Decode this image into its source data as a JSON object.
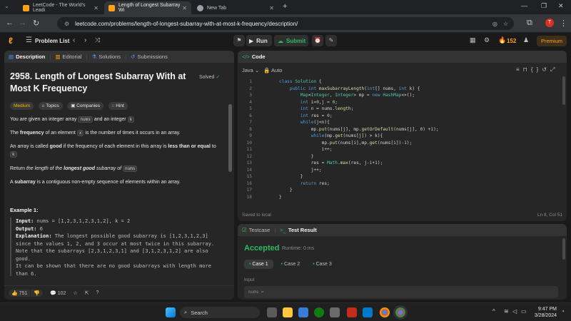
{
  "browser": {
    "tabs": [
      {
        "title": "LeetCode - The World's Leadi",
        "active": false
      },
      {
        "title": "Length of Longest Subarray Wi",
        "active": true
      },
      {
        "title": "New Tab",
        "active": false
      }
    ],
    "url": "leetcode.com/problems/length-of-longest-subarray-with-at-most-k-frequency/description/"
  },
  "lc_top": {
    "problem_list": "Problem List",
    "run": "Run",
    "submit": "Submit",
    "streak": "152",
    "premium": "Premium"
  },
  "desc_panel": {
    "tabs": [
      "Description",
      "Editorial",
      "Solutions",
      "Submissions"
    ],
    "title": "2958. Length of Longest Subarray With at Most K Frequency",
    "solved": "Solved",
    "difficulty": "Medium",
    "chips": [
      "Topics",
      "Companies",
      "Hint"
    ],
    "p1_a": "You are given an integer array",
    "p1_code1": "nums",
    "p1_b": "and an integer",
    "p1_code2": "k",
    "p2_a": "The",
    "p2_bold": "frequency",
    "p2_b": "of an element",
    "p2_code": "x",
    "p2_c": "is the number of times it occurs in an array.",
    "p3_a": "An array is called",
    "p3_bold1": "good",
    "p3_b": "if the frequency of each element in this array is",
    "p3_bold2": "less than or equal",
    "p3_c": "to",
    "p3_code": "k",
    "p4_a": "Return",
    "p4_i1": "the length of the",
    "p4_bold": "longest good",
    "p4_i2": "subarray of",
    "p4_code": "nums",
    "p5_a": "A",
    "p5_bold": "subarray",
    "p5_b": "is a contiguous non-empty sequence of elements within an array.",
    "example_title": "Example 1:",
    "ex_input_label": "Input:",
    "ex_input": "nums = [1,2,3,1,2,3,1,2], k = 2",
    "ex_output_label": "Output:",
    "ex_output": "6",
    "ex_expl_label": "Explanation:",
    "ex_expl": "The longest possible good subarray is [1,2,3,1,2,3] since the values 1, 2, and 3 occur at most twice in this subarray. Note that the subarrays [2,3,1,2,3,1] and [3,1,2,3,1,2] are also good.",
    "ex_expl2": "It can be shown that there are no good subarrays with length more than 6.",
    "likes": "751",
    "comments": "102"
  },
  "code_panel": {
    "tab": "Code",
    "language": "Java",
    "auto": "Auto",
    "lines": [
      "class Solution {",
      "    public int maxSubarrayLength(int[] nums, int k) {",
      "        Map<Integer, Integer> mp = new HashMap<>();",
      "        int i=0,j = 0;",
      "        int n = nums.length;",
      "        int res = 0;",
      "        while(j<n){",
      "            mp.put(nums[j], mp.getOrDefault(nums[j], 0) +1);",
      "            while(mp.get(nums[j]) > k){",
      "                mp.put(nums[i],mp.get(nums[i])-1);",
      "                i++;",
      "            }",
      "            res = Math.max(res, j-i+1);",
      "            j++;",
      "        }",
      "        return res;",
      "    }",
      "}"
    ],
    "saved": "Saved to local",
    "cursor": "Ln 8, Col 51"
  },
  "test_panel": {
    "tab1": "Testcase",
    "tab2": "Test Result",
    "status": "Accepted",
    "runtime": "Runtime: 0 ms",
    "cases": [
      "Case 1",
      "Case 2",
      "Case 3"
    ],
    "input_label": "Input",
    "input_value": "nums ="
  },
  "taskbar": {
    "search": "Search",
    "time": "9:47 PM",
    "date": "3/28/2024"
  },
  "colors": {
    "accepted": "#2cbb5d",
    "medium": "#ffb800",
    "submit": "#2cbb5d"
  }
}
